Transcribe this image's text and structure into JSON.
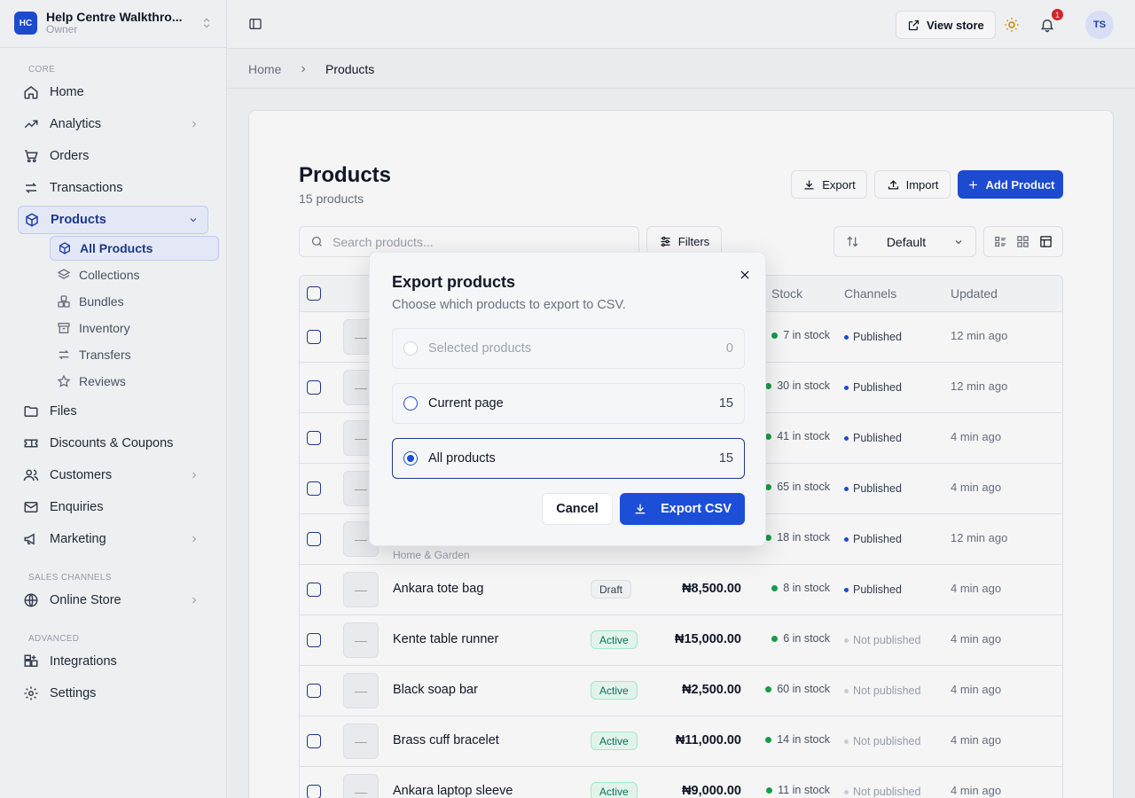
{
  "brand": {
    "initials": "HC",
    "name": "Help Centre Walkthro...",
    "role": "Owner"
  },
  "sidebar": {
    "core_label": "CORE",
    "sales_label": "SALES CHANNELS",
    "advanced_label": "ADVANCED",
    "items": {
      "home": "Home",
      "analytics": "Analytics",
      "orders": "Orders",
      "transactions": "Transactions",
      "products": "Products",
      "files": "Files",
      "discounts": "Discounts & Coupons",
      "customers": "Customers",
      "enquiries": "Enquiries",
      "marketing": "Marketing",
      "online_store": "Online Store",
      "integrations": "Integrations",
      "settings": "Settings"
    },
    "sub_items": {
      "all_products": "All Products",
      "collections": "Collections",
      "bundles": "Bundles",
      "inventory": "Inventory",
      "transfers": "Transfers",
      "reviews": "Reviews"
    }
  },
  "header": {
    "view_store": "View store",
    "notification_count": "1",
    "avatar_initials": "TS"
  },
  "breadcrumb": {
    "home": "Home",
    "current": "Products"
  },
  "page": {
    "title": "Products",
    "count": "15 products",
    "export_label": "Export",
    "import_label": "Import",
    "add_label": "Add Product",
    "search_placeholder": "Search products...",
    "filters_label": "Filters",
    "sort_label": "Default"
  },
  "table": {
    "headers": {
      "stock": "Stock",
      "channels": "Channels",
      "updated": "Updated"
    },
    "rows": [
      {
        "name": "",
        "category": "",
        "status": "",
        "price": "",
        "stock": "7 in stock",
        "channel": "Published",
        "updated": "12 min ago"
      },
      {
        "name": "",
        "category": "",
        "status": "",
        "price": "",
        "stock": "30 in stock",
        "channel": "Published",
        "updated": "12 min ago"
      },
      {
        "name": "",
        "category": "",
        "status": "",
        "price": "",
        "stock": "41 in stock",
        "channel": "Published",
        "updated": "4 min ago"
      },
      {
        "name": "",
        "category": "",
        "status": "",
        "price": "",
        "stock": "65 in stock",
        "channel": "Published",
        "updated": "4 min ago"
      },
      {
        "name": "",
        "category": "Home & Garden",
        "status": "",
        "price": "",
        "stock": "18 in stock",
        "channel": "Published",
        "updated": "12 min ago"
      },
      {
        "name": "Ankara tote bag",
        "category": "",
        "status": "Draft",
        "price": "₦8,500.00",
        "stock": "8 in stock",
        "channel": "Published",
        "updated": "4 min ago"
      },
      {
        "name": "Kente table runner",
        "category": "",
        "status": "Active",
        "price": "₦15,000.00",
        "stock": "6 in stock",
        "channel": "Not published",
        "updated": "4 min ago"
      },
      {
        "name": "Black soap bar",
        "category": "",
        "status": "Active",
        "price": "₦2,500.00",
        "stock": "60 in stock",
        "channel": "Not published",
        "updated": "4 min ago"
      },
      {
        "name": "Brass cuff bracelet",
        "category": "",
        "status": "Active",
        "price": "₦11,000.00",
        "stock": "14 in stock",
        "channel": "Not published",
        "updated": "4 min ago"
      },
      {
        "name": "Ankara laptop sleeve",
        "category": "",
        "status": "Active",
        "price": "₦9,000.00",
        "stock": "11 in stock",
        "channel": "Not published",
        "updated": "4 min ago"
      }
    ]
  },
  "modal": {
    "title": "Export products",
    "description": "Choose which products to export to CSV.",
    "options": [
      {
        "label": "Selected products",
        "count": "0"
      },
      {
        "label": "Current page",
        "count": "15"
      },
      {
        "label": "All products",
        "count": "15"
      }
    ],
    "cancel_label": "Cancel",
    "export_label": "Export CSV"
  }
}
